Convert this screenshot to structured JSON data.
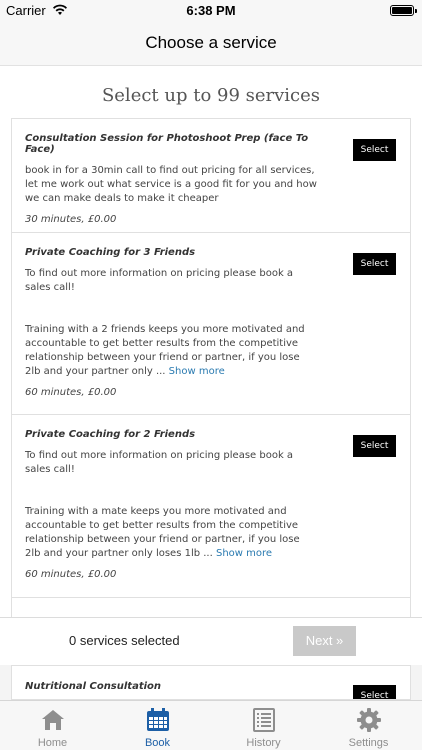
{
  "status_bar": {
    "carrier": "Carrier",
    "time": "6:38 PM"
  },
  "nav": {
    "title": "Choose a service"
  },
  "heading": "Select up to 99 services",
  "services": [
    {
      "name": "Consultation Session for Photoshoot Prep (face To Face)",
      "description": "book in for a 30min call to find out pricing for all services, let me work out what service is a good fit for you and how we can make deals to make it cheaper",
      "show_more": "",
      "meta": "30 minutes, £0.00",
      "select_label": "Select"
    },
    {
      "name": "Private Coaching for 3 Friends",
      "description": "To find out more information on pricing please book a sales call!\n\n\nTraining with a 2 friends keeps you more motivated and accountable to get better results from the competitive relationship between your friend or partner, if you lose 2lb and your partner only ...",
      "show_more": "Show more",
      "meta": "60 minutes, £0.00",
      "select_label": "Select"
    },
    {
      "name": "Private Coaching for 2 Friends",
      "description": "To find out more information on pricing please book a sales call!\n\n\nTraining with a mate keeps you more motivated and accountable to get better results from the competitive relationship between your friend or partner, if you lose 2lb and your partner only loses 1lb ...",
      "show_more": "Show more",
      "meta": "60 minutes, £0.00",
      "select_label": "Select"
    },
    {
      "name": "Nutritional Consultation",
      "select_label": "Select"
    }
  ],
  "selection_bar": {
    "count_text": "0 services selected",
    "next_label": "Next »"
  },
  "tabs": [
    {
      "label": "Home",
      "icon": "home-icon",
      "active": false
    },
    {
      "label": "Book",
      "icon": "calendar-icon",
      "active": true
    },
    {
      "label": "History",
      "icon": "history-icon",
      "active": false
    },
    {
      "label": "Settings",
      "icon": "gear-icon",
      "active": false
    }
  ],
  "colors": {
    "accent": "#1d5fa6",
    "button": "#000000",
    "disabled_button": "#c9c9c9",
    "link": "#2a7ab0"
  }
}
